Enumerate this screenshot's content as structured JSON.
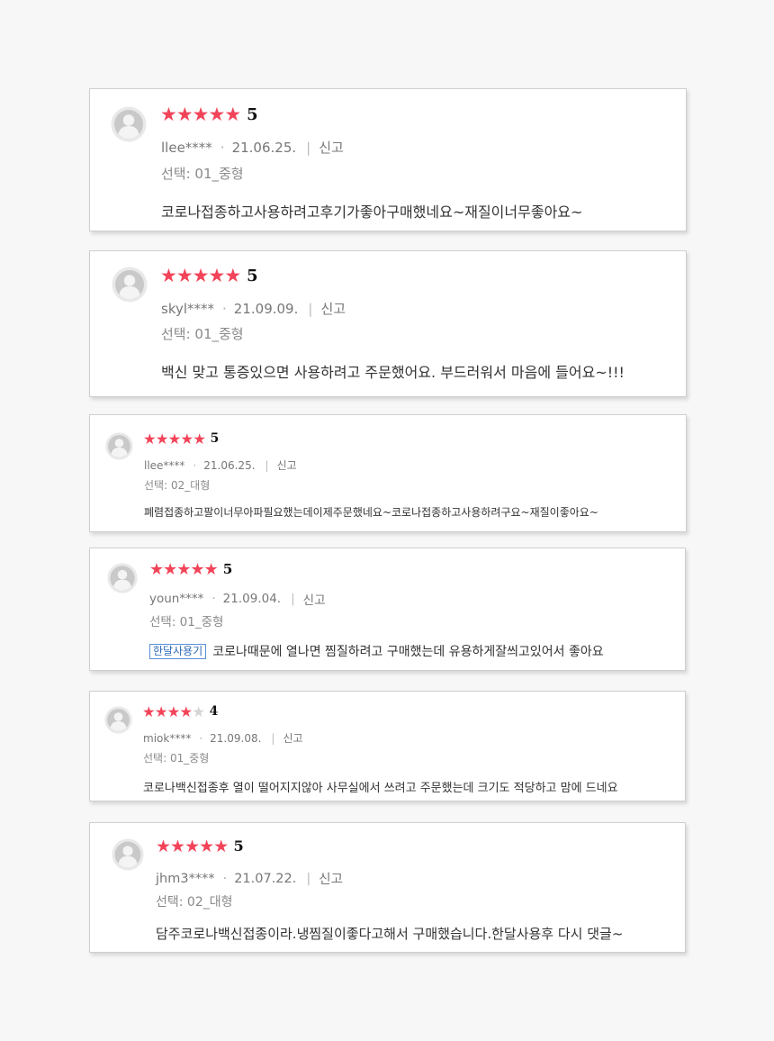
{
  "reviews": [
    {
      "rating": "5",
      "stars_filled": 5,
      "user": "llee****",
      "date": "21.06.25.",
      "report": "신고",
      "option": "선택: 01_중형",
      "tag": "",
      "text": "코로나접종하고사용하려고후기가좋아구매했네요~재질이너무좋아요~"
    },
    {
      "rating": "5",
      "stars_filled": 5,
      "user": "skyl****",
      "date": "21.09.09.",
      "report": "신고",
      "option": "선택: 01_중형",
      "tag": "",
      "text": "백신 맞고 통증있으면 사용하려고 주문했어요. 부드러워서 마음에 들어요~!!!"
    },
    {
      "rating": "5",
      "stars_filled": 5,
      "user": "llee****",
      "date": "21.06.25.",
      "report": "신고",
      "option": "선택: 02_대형",
      "tag": "",
      "text": "폐렴접종하고팔이너무아파필요했는데이제주문했네요~코로나접종하고사용하려구요~재질이좋아요~"
    },
    {
      "rating": "5",
      "stars_filled": 5,
      "user": "youn****",
      "date": "21.09.04.",
      "report": "신고",
      "option": "선택: 01_중형",
      "tag": "한달사용기",
      "text": "코로나때문에 열나면 찜질하려고 구매했는데 유용하게잘씌고있어서 좋아요"
    },
    {
      "rating": "4",
      "stars_filled": 4,
      "user": "miok****",
      "date": "21.09.08.",
      "report": "신고",
      "option": "선택: 01_중형",
      "tag": "",
      "text": "코로나백신접종후 열이 떨어지지않아 사무실에서 쓰려고 주문했는데 크기도 적당하고 맘에 드네요"
    },
    {
      "rating": "5",
      "stars_filled": 5,
      "user": "jhm3****",
      "date": "21.07.22.",
      "report": "신고",
      "option": "선택: 02_대형",
      "tag": "",
      "text": "담주코로나백신접종이라.냉찜질이좋다고해서 구매했습니다.한달사용후 다시 댓글~"
    }
  ]
}
